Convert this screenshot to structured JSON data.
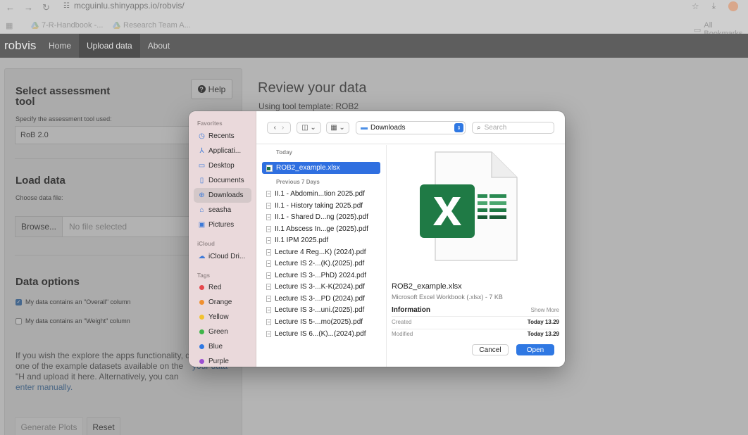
{
  "browser": {
    "url": "mcguinlu.shinyapps.io/robvis/",
    "bookmarks": [
      "7-R-Handbook -...",
      "Research Team A..."
    ],
    "all_bookmarks": "All Bookmarks"
  },
  "navbar": {
    "brand": "robvis",
    "items": [
      "Home",
      "Upload data",
      "About"
    ],
    "active": "Upload data"
  },
  "sidebar": {
    "help_label": "Help",
    "select_tool": {
      "title_line1": "Select assessment",
      "title_line2": "tool",
      "label": "Specify the assessment tool used:",
      "value": "RoB 2.0"
    },
    "load_data": {
      "title": "Load data",
      "label": "Choose data file:",
      "browse_label": "Browse...",
      "file_placeholder": "No file selected"
    },
    "data_options": {
      "title": "Data options",
      "overall_label": "My data contains an \"Overall\" column",
      "overall_checked": true,
      "weight_label": "My data contains an \"Weight\" column",
      "weight_checked": false
    },
    "info_text_left": "If you wish the explore the apps functionality, d one of the example datasets available on the \"H and upload it here. Alternatively, you can",
    "info_link": "enter",
    "info_manual": "manually.",
    "info_text_right": "your data",
    "generate_label": "Generate Plots",
    "reset_label": "Reset"
  },
  "main": {
    "title": "Review your data",
    "subtitle": "Using tool template: ROB2"
  },
  "dialog": {
    "sidebar": {
      "favorites_header": "Favorites",
      "favorites": [
        {
          "label": "Recents",
          "icon": "clock-icon"
        },
        {
          "label": "Applicati...",
          "icon": "applications-icon"
        },
        {
          "label": "Desktop",
          "icon": "desktop-icon"
        },
        {
          "label": "Documents",
          "icon": "document-icon"
        },
        {
          "label": "Downloads",
          "icon": "download-icon"
        },
        {
          "label": "seasha",
          "icon": "home-icon"
        },
        {
          "label": "Pictures",
          "icon": "pictures-icon"
        }
      ],
      "icloud_header": "iCloud",
      "icloud_item": "iCloud Dri...",
      "tags_header": "Tags",
      "tags": [
        {
          "label": "Red",
          "color": "#e5484d"
        },
        {
          "label": "Orange",
          "color": "#f0902f"
        },
        {
          "label": "Yellow",
          "color": "#f2c230"
        },
        {
          "label": "Green",
          "color": "#3fb54a"
        },
        {
          "label": "Blue",
          "color": "#2f78e3"
        },
        {
          "label": "Purple",
          "color": "#9b4fd1"
        }
      ]
    },
    "toolbar": {
      "location": "Downloads",
      "search_placeholder": "Search"
    },
    "list": {
      "today_header": "Today",
      "selected_file": "ROB2_example.xlsx",
      "previous_header": "Previous 7 Days",
      "files": [
        "II.1 - Abdomin...tion 2025.pdf",
        "II.1 - History taking 2025.pdf",
        "II.1 - Shared D...ng (2025).pdf",
        "II.1 Abscess In...ge (2025).pdf",
        "II.1 IPM 2025.pdf",
        "Lecture 4 Reg...K) (2024).pdf",
        "Lecture IS 2-...(K).(2025).pdf",
        "Lecture IS 3-...PhD) 2024.pdf",
        "Lecture IS 3-...K-K(2024).pdf",
        "Lecture IS 3-...PD (2024).pdf",
        "Lecture IS 3-...uni.(2025).pdf",
        "Lecture IS 5-...mo(2025).pdf",
        "Lecture IS 6...(K)...(2024).pdf"
      ]
    },
    "preview": {
      "name": "ROB2_example.xlsx",
      "kind": "Microsoft Excel Workbook (.xlsx) - 7 KB",
      "info_header": "Information",
      "show_more": "Show More",
      "created_label": "Created",
      "created_value": "Today 13.29",
      "modified_label": "Modified",
      "modified_value": "Today 13.29"
    },
    "cancel_label": "Cancel",
    "open_label": "Open"
  }
}
